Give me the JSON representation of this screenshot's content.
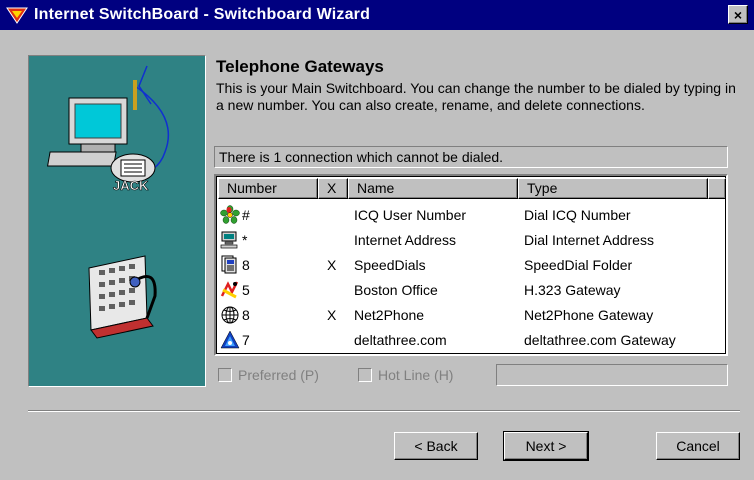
{
  "window": {
    "title": "Internet SwitchBoard - Switchboard Wizard",
    "close_glyph": "×",
    "icon": "switchboard-app-icon"
  },
  "art": {
    "jack_label": "JACK"
  },
  "heading": "Telephone Gateways",
  "description": "This is your Main Switchboard. You can change the number to be dialed by typing in a new number. You can also create, rename, and delete connections.",
  "status": "There is 1 connection which cannot be dialed.",
  "list": {
    "headers": {
      "number": "Number",
      "x": "X",
      "name": "Name",
      "type": "Type"
    },
    "rows": [
      {
        "icon": "icq-flower-icon",
        "number": "#",
        "mark": "",
        "name": "ICQ User Number",
        "type": "Dial ICQ Number"
      },
      {
        "icon": "internet-computer-icon",
        "number": "*",
        "mark": "",
        "name": "Internet Address",
        "type": "Dial Internet Address"
      },
      {
        "icon": "speeddial-folder-icon",
        "number": "8",
        "mark": "X",
        "name": "SpeedDials",
        "type": "SpeedDial Folder"
      },
      {
        "icon": "h323-gateway-icon",
        "number": "5",
        "mark": "",
        "name": "Boston Office",
        "type": "H.323 Gateway"
      },
      {
        "icon": "net2phone-globe-icon",
        "number": "8",
        "mark": "X",
        "name": "Net2Phone",
        "type": "Net2Phone Gateway"
      },
      {
        "icon": "deltathree-icon",
        "number": "7",
        "mark": "",
        "name": "deltathree.com",
        "type": "deltathree.com Gateway"
      }
    ]
  },
  "options": {
    "preferred_label": "Preferred (P)",
    "hotline_label": "Hot Line (H)"
  },
  "buttons": {
    "back": "< Back",
    "next": "Next >",
    "cancel": "Cancel"
  },
  "colors": {
    "titlebar": "#000080",
    "art_panel": "#2f8284",
    "face": "#c0c0c0"
  }
}
